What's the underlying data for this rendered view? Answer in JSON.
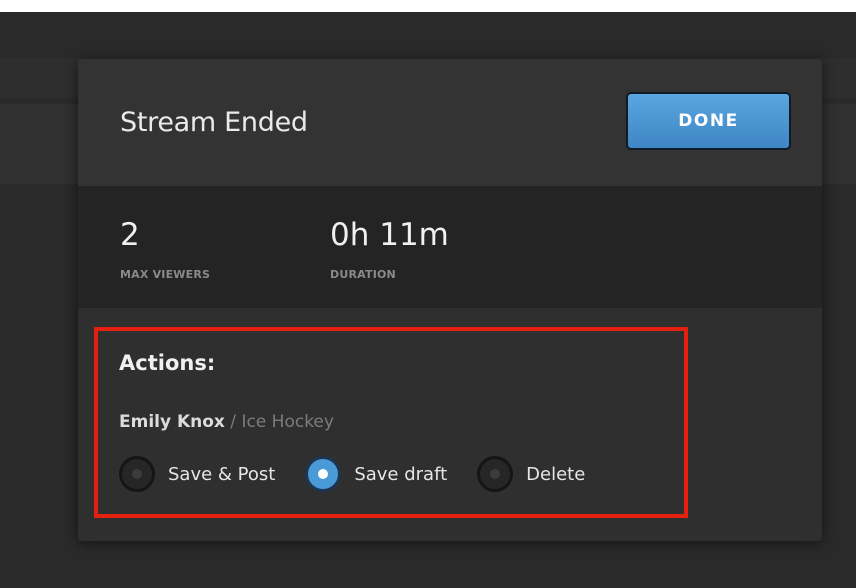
{
  "dialog": {
    "title": "Stream Ended",
    "done_label": "DONE"
  },
  "stats": {
    "viewers": {
      "value": "2",
      "label": "MAX VIEWERS"
    },
    "duration": {
      "value": "0h 11m",
      "label": "DURATION"
    }
  },
  "actions": {
    "heading": "Actions:",
    "stream_owner": "Emily Knox",
    "stream_game": " / Ice Hockey",
    "options": [
      {
        "label": "Save & Post",
        "selected": false
      },
      {
        "label": "Save draft",
        "selected": true
      },
      {
        "label": "Delete",
        "selected": false
      }
    ]
  },
  "colors": {
    "accent": "#4a9ad8",
    "highlight_border": "#e5200f"
  }
}
